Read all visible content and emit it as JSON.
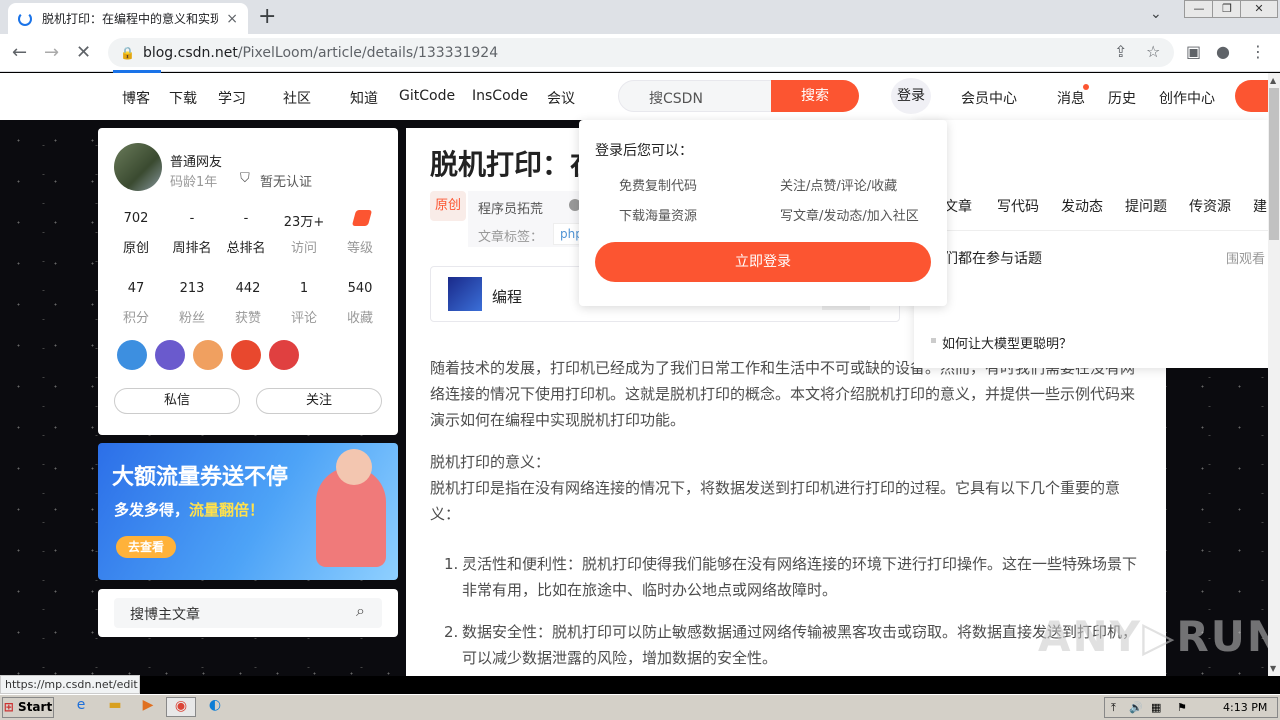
{
  "browser": {
    "tab_title": "脱机打印：在编程中的意义和实现-C",
    "tab_close": "×",
    "new_tab": "+",
    "url_domain": "blog.csdn.net",
    "url_path": "/PixelLoom/article/details/133331924",
    "status_url": "https://mp.csdn.net/edit"
  },
  "csdn_nav": {
    "items": [
      "博客",
      "下载",
      "学习",
      "社区",
      "知道",
      "GitCode",
      "InsCode",
      "会议"
    ],
    "search_placeholder": "搜CSDN",
    "search_button": "搜索",
    "login": "登录",
    "right_items": [
      "会员中心",
      "消息",
      "历史",
      "创作中心"
    ]
  },
  "profile": {
    "name": "普通网友",
    "age": "码龄1年",
    "cert": "暂无认证",
    "stats_row1": [
      {
        "value": "702",
        "label": "原创"
      },
      {
        "value": "-",
        "label": "周排名"
      },
      {
        "value": "-",
        "label": "总排名"
      },
      {
        "value": "23万+",
        "label": "访问"
      },
      {
        "value": "",
        "label": "等级"
      }
    ],
    "stats_row2": [
      {
        "value": "47",
        "label": "积分"
      },
      {
        "value": "213",
        "label": "粉丝"
      },
      {
        "value": "442",
        "label": "获赞"
      },
      {
        "value": "1",
        "label": "评论"
      },
      {
        "value": "540",
        "label": "收藏"
      }
    ],
    "message_button": "私信",
    "follow_button": "关注"
  },
  "ad": {
    "headline": "大额流量券送不停",
    "sub_a": "多发多得，",
    "sub_b": "流量翻倍！",
    "cta": "去查看"
  },
  "blog_search": {
    "placeholder": "搜博主文章"
  },
  "article": {
    "title_visible": "脱机打印：在",
    "badge": "原创",
    "author": "程序员拓荒",
    "tags_label": "文章标签：",
    "tag": "php",
    "column_name": "编程",
    "para1": "随着技术的发展，打印机已经成为了我们日常工作和生活中不可或缺的设备。然而，有时我们需要在没有网络连接的情况下使用打印机。这就是脱机打印的概念。本文将介绍脱机打印的意义，并提供一些示例代码来演示如何在编程中实现脱机打印功能。",
    "heading": "脱机打印的意义：",
    "para2": "脱机打印是指在没有网络连接的情况下，将数据发送到打印机进行打印的过程。它具有以下几个重要的意义：",
    "list": [
      "灵活性和便利性：脱机打印使得我们能够在没有网络连接的环境下进行打印操作。这在一些特殊场景下非常有用，比如在旅途中、临时办公地点或网络故障时。",
      "数据安全性：脱机打印可以防止敏感数据通过网络传输被黑客攻击或窃取。将数据直接发送到打印机，可以减少数据泄露的风险，增加数据的安全性。"
    ]
  },
  "login_popup": {
    "title": "登录后您可以：",
    "items": [
      "免费复制代码",
      "关注/点赞/评论/收藏",
      "下载海量资源",
      "写文章/发动态/加入社区"
    ],
    "button": "立即登录"
  },
  "creation_menu": {
    "items": [
      "文章",
      "写代码",
      "发动态",
      "提问题",
      "传资源",
      "建"
    ],
    "topic_title": "们都在参与话题",
    "topic_more": "围观看",
    "topic_item": "如何让大模型更聪明？"
  },
  "taskbar": {
    "start": "Start",
    "time": "4:13 PM"
  },
  "watermark": "ANY RUN"
}
